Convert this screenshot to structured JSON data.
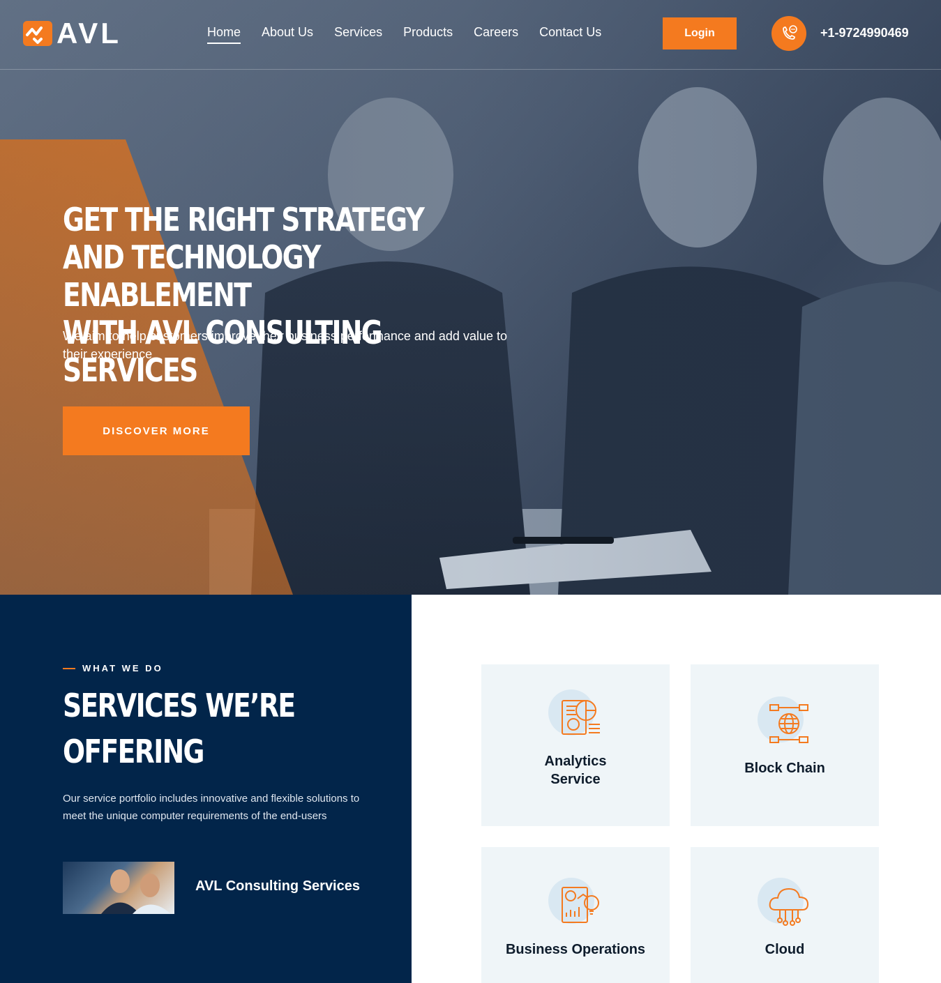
{
  "brand": {
    "name": "AVL"
  },
  "nav": {
    "items": [
      {
        "label": "Home",
        "active": true
      },
      {
        "label": "About Us"
      },
      {
        "label": "Services"
      },
      {
        "label": "Products"
      },
      {
        "label": "Careers"
      },
      {
        "label": "Contact Us"
      }
    ],
    "login_label": "Login",
    "phone": "+1-9724990469"
  },
  "hero": {
    "title_line1": "GET THE RIGHT STRATEGY",
    "title_line2": "AND TECHNOLOGY ENABLEMENT",
    "title_line3": "WITH AVL CONSULTING SERVICES",
    "subtitle": "We aim to help customers improve their business performance and add value to their experience",
    "cta_label": "DISCOVER MORE"
  },
  "services": {
    "eyebrow": "WHAT WE DO",
    "title_line1": "SERVICES WE’RE",
    "title_line2": "OFFERING",
    "description": "Our service portfolio includes innovative and flexible solutions to meet the unique computer requirements of the end-users",
    "featured_label": "AVL Consulting Services",
    "cards": [
      {
        "label_line1": "Analytics",
        "label_line2": "Service",
        "icon": "analytics-icon"
      },
      {
        "label_line1": "Block Chain",
        "label_line2": "",
        "icon": "blockchain-icon"
      },
      {
        "label_line1": "Business Operations",
        "label_line2": "",
        "icon": "business-operations-icon"
      },
      {
        "label_line1": "Cloud",
        "label_line2": "",
        "icon": "cloud-icon"
      }
    ]
  },
  "colors": {
    "accent": "#f47a1f",
    "navy": "#02254a",
    "card_bg": "#eff5f8"
  }
}
